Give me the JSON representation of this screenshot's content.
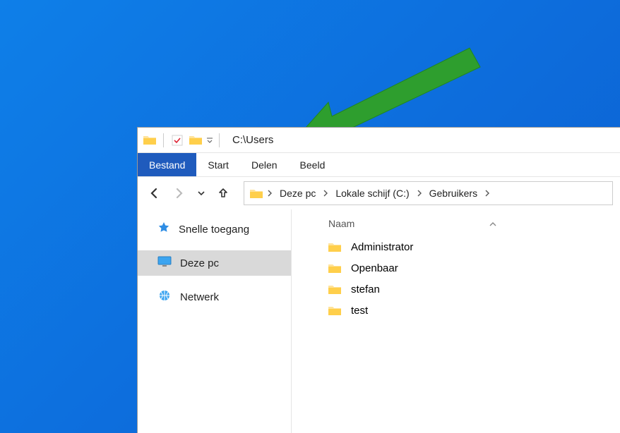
{
  "title": "C:\\Users",
  "menu": {
    "file": "Bestand",
    "home": "Start",
    "share": "Delen",
    "view": "Beeld"
  },
  "breadcrumb": {
    "this_pc": "Deze pc",
    "drive": "Lokale schijf (C:)",
    "users": "Gebruikers"
  },
  "sidebar": {
    "quick": "Snelle toegang",
    "this_pc": "Deze pc",
    "network": "Netwerk"
  },
  "columns": {
    "name": "Naam"
  },
  "files": [
    {
      "name": "Administrator"
    },
    {
      "name": "Openbaar"
    },
    {
      "name": "stefan"
    },
    {
      "name": "test"
    }
  ]
}
